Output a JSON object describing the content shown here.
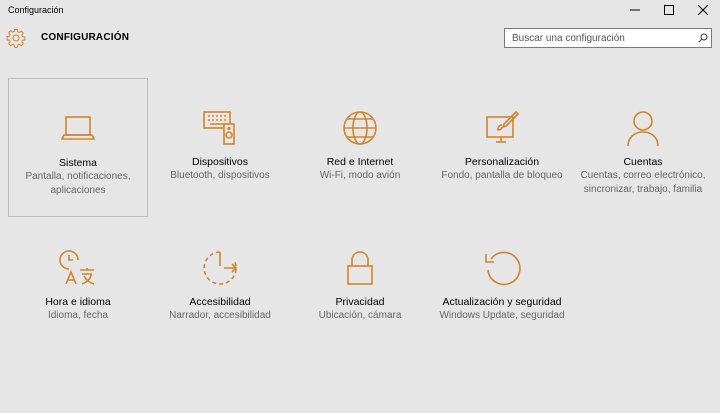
{
  "window": {
    "title": "Configuración"
  },
  "header": {
    "title": "CONFIGURACIÓN"
  },
  "search": {
    "placeholder": "Buscar una configuración"
  },
  "accent_color": "#d0862a",
  "tiles": [
    {
      "icon": "laptop-icon",
      "name": "Sistema",
      "desc": "Pantalla, notificaciones, aplicaciones"
    },
    {
      "icon": "devices-icon",
      "name": "Dispositivos",
      "desc": "Bluetooth, dispositivos"
    },
    {
      "icon": "globe-icon",
      "name": "Red e Internet",
      "desc": "Wi-Fi, modo avión"
    },
    {
      "icon": "paint-icon",
      "name": "Personalización",
      "desc": "Fondo, pantalla de bloqueo"
    },
    {
      "icon": "person-icon",
      "name": "Cuentas",
      "desc": "Cuentas, correo electrónico, sincronizar, trabajo, familia"
    },
    {
      "icon": "time-language-icon",
      "name": "Hora e idioma",
      "desc": "Idioma, fecha"
    },
    {
      "icon": "accessibility-icon",
      "name": "Accesibilidad",
      "desc": "Narrador, accesibilidad"
    },
    {
      "icon": "lock-icon",
      "name": "Privacidad",
      "desc": "Ubicación, cámara"
    },
    {
      "icon": "update-icon",
      "name": "Actualización y seguridad",
      "desc": "Windows Update, seguridad"
    }
  ]
}
